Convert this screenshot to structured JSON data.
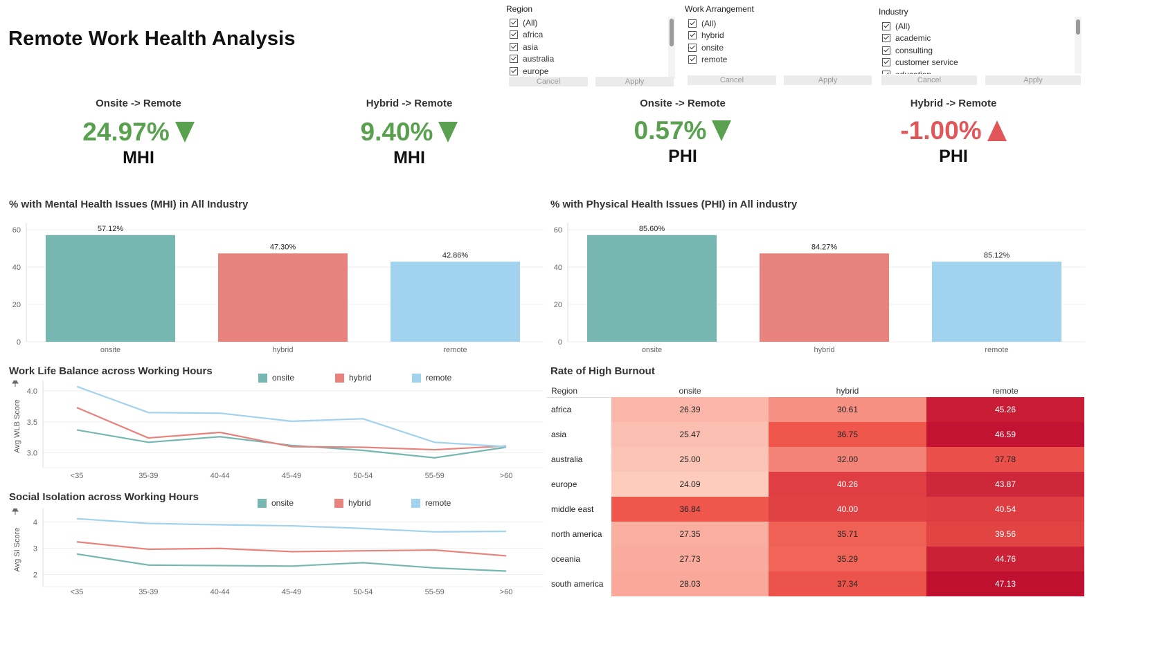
{
  "title": "Remote Work Health Analysis",
  "filters": {
    "region": {
      "title": "Region",
      "items": [
        "(All)",
        "africa",
        "asia",
        "australia",
        "europe"
      ],
      "cancel": "Cancel",
      "apply": "Apply"
    },
    "work": {
      "title": "Work Arrangement",
      "items": [
        "(All)",
        "hybrid",
        "onsite",
        "remote"
      ],
      "cancel": "Cancel",
      "apply": "Apply"
    },
    "industry": {
      "title": "Industry",
      "items": [
        "(All)",
        "academic",
        "consulting",
        "customer service",
        "education"
      ],
      "cancel": "Cancel",
      "apply": "Apply"
    }
  },
  "kpis": [
    {
      "label": "Onsite -> Remote",
      "value": "24.97%",
      "metric": "MHI",
      "direction": "down",
      "color": "#59a14f"
    },
    {
      "label": "Hybrid -> Remote",
      "value": "9.40%",
      "metric": "MHI",
      "direction": "down",
      "color": "#59a14f"
    },
    {
      "label": "Onsite -> Remote",
      "value": "0.57%",
      "metric": "PHI",
      "direction": "down",
      "color": "#59a14f"
    },
    {
      "label": "Hybrid -> Remote",
      "value": "-1.00%",
      "metric": "PHI",
      "direction": "up",
      "color": "#e15759"
    }
  ],
  "colors": {
    "onsite": "#76b7b2",
    "hybrid": "#e8827d",
    "remote": "#a1d2ee",
    "grid": "#eeeeee",
    "axis": "#777777"
  },
  "legend": [
    "onsite",
    "hybrid",
    "remote"
  ],
  "chart_data": [
    {
      "type": "bar",
      "title": "% with Mental Health Issues (MHI) in All Industry",
      "categories": [
        "onsite",
        "hybrid",
        "remote"
      ],
      "values": [
        57.12,
        47.3,
        42.86
      ],
      "data_labels": [
        "57.12%",
        "47.30%",
        "42.86%"
      ],
      "yticks": [
        "60",
        "40",
        "20",
        "0"
      ],
      "ylim": [
        0,
        60
      ],
      "grid": true
    },
    {
      "type": "bar",
      "title": "% with Physical Health Issues (PHI) in All industry",
      "categories": [
        "onsite",
        "hybrid",
        "remote"
      ],
      "values": [
        57.12,
        47.3,
        42.86
      ],
      "data_labels": [
        "85.60%",
        "84.27%",
        "85.12%"
      ],
      "yticks": [
        "60",
        "40",
        "20",
        "0"
      ],
      "ylim": [
        0,
        60
      ],
      "grid": true
    },
    {
      "type": "line",
      "title": "Work Life Balance across Working Hours",
      "ylabel": "Avg WLB Score",
      "x": [
        "<35",
        "35-39",
        "40-44",
        "45-49",
        "50-54",
        "55-59",
        ">60"
      ],
      "yticks": [
        "4.0",
        "3.5",
        "3.0"
      ],
      "ylim": [
        2.85,
        4.1
      ],
      "series": [
        {
          "name": "onsite",
          "values": [
            3.37,
            3.17,
            3.26,
            3.12,
            3.04,
            2.92,
            3.09
          ]
        },
        {
          "name": "hybrid",
          "values": [
            3.73,
            3.24,
            3.33,
            3.1,
            3.09,
            3.05,
            3.11
          ]
        },
        {
          "name": "remote",
          "values": [
            4.07,
            3.65,
            3.64,
            3.51,
            3.55,
            3.17,
            3.1
          ]
        }
      ],
      "legend_position": "top"
    },
    {
      "type": "line",
      "title": "Social Isolation across Working Hours",
      "ylabel": "Avg SI Score",
      "x": [
        "<35",
        "35-39",
        "40-44",
        "45-49",
        "50-54",
        "55-59",
        ">60"
      ],
      "yticks": [
        "4",
        "3",
        "2"
      ],
      "ylim": [
        1.75,
        4.35
      ],
      "series": [
        {
          "name": "onsite",
          "values": [
            2.78,
            2.36,
            2.34,
            2.32,
            2.45,
            2.25,
            2.13
          ]
        },
        {
          "name": "hybrid",
          "values": [
            3.24,
            2.96,
            2.99,
            2.87,
            2.9,
            2.93,
            2.71
          ]
        },
        {
          "name": "remote",
          "values": [
            4.12,
            3.94,
            3.89,
            3.85,
            3.75,
            3.62,
            3.64
          ]
        }
      ],
      "legend_position": "top"
    },
    {
      "type": "heatmap",
      "title": "Rate of High Burnout",
      "row_header": "Region",
      "columns": [
        "onsite",
        "hybrid",
        "remote"
      ],
      "rows": [
        "africa",
        "asia",
        "australia",
        "europe",
        "middle east",
        "north america",
        "oceania",
        "south america"
      ],
      "values": [
        [
          "26.39",
          "30.61",
          "45.26"
        ],
        [
          "25.47",
          "36.75",
          "46.59"
        ],
        [
          "25.00",
          "32.00",
          "37.78"
        ],
        [
          "24.09",
          "40.26",
          "43.87"
        ],
        [
          "36.84",
          "40.00",
          "40.54"
        ],
        [
          "27.35",
          "35.71",
          "39.56"
        ],
        [
          "27.73",
          "35.29",
          "44.76"
        ],
        [
          "28.03",
          "37.34",
          "47.13"
        ]
      ]
    }
  ]
}
